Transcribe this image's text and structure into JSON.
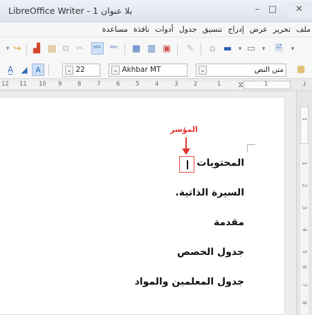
{
  "window": {
    "title": "بلا عنوان 1 - LibreOffice Writer",
    "minimize_label": "–",
    "maximize_label": "□",
    "close_label": "✕"
  },
  "menu": [
    "ملف",
    "تحرير",
    "عرض",
    "إدراج",
    "تنسيق",
    "جدول",
    "أدوات",
    "نافذة",
    "مساعدة"
  ],
  "toolbar_format": {
    "paragraph_style": "متن النص",
    "font_name": "Akhbar MT",
    "font_size": "22"
  },
  "ruler": {
    "numbers": [
      "12",
      "11",
      "10",
      "9",
      "8",
      "7",
      "6",
      "5",
      "4",
      "3",
      "2",
      "1",
      "1"
    ]
  },
  "vertical_ruler": {
    "numbers": [
      "1",
      "1",
      "2",
      "3",
      "4",
      "5",
      "6",
      "7",
      "8"
    ]
  },
  "document": {
    "lines": [
      "المحتويات",
      "السيرة الذاتية.",
      "مقدمة",
      "جدول الحصص",
      "جدول المعلمين والمواد"
    ],
    "cursor_label": "المؤشر"
  }
}
